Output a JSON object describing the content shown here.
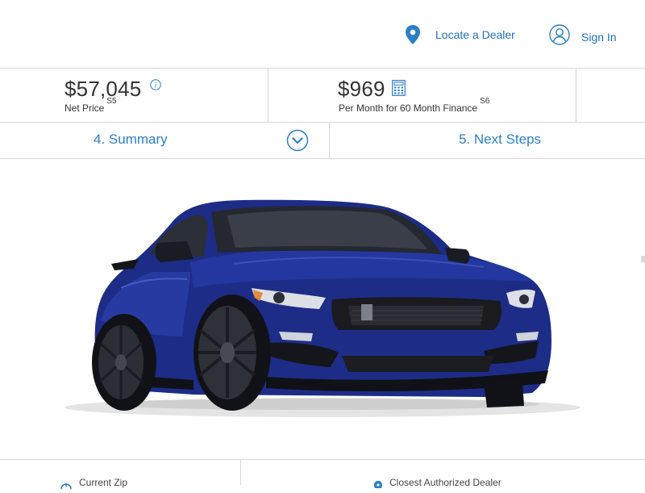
{
  "header": {
    "locate_label": "Locate a Dealer",
    "signin_label": "Sign In",
    "accent": "#1f6fb5"
  },
  "pricing": {
    "net_price": "$57,045",
    "net_price_label": "Net Price",
    "net_price_note": "S5",
    "monthly": "$969",
    "monthly_label": "Per Month for 60 Month Finance",
    "monthly_note": "S6"
  },
  "steps": [
    {
      "label": "4. Summary",
      "expanded_icon": "chevron-down-circle-icon"
    },
    {
      "label": "5. Next Steps"
    }
  ],
  "vehicle": {
    "body_color": "#1d2c86"
  },
  "bottom": {
    "zip_label": "Current Zip",
    "dealer_label": "Closest Authorized Dealer"
  },
  "icons": [
    "location-pin-icon",
    "user-icon",
    "info-icon",
    "calculator-icon",
    "chevron-down-icon",
    "zip-icon",
    "dealer-pin-icon"
  ]
}
